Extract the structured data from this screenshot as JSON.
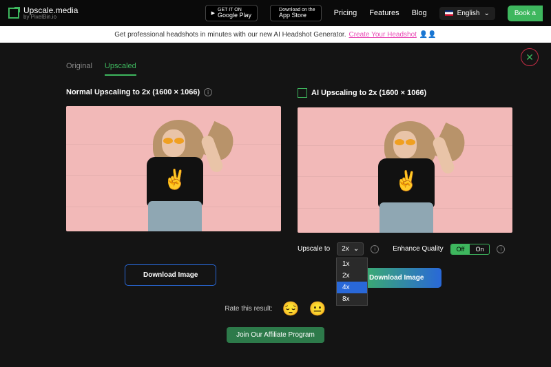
{
  "header": {
    "logo_name": "Upscale.media",
    "logo_sub": "by PixelBin.io",
    "store_google_top": "GET IT ON",
    "store_google_bottom": "Google Play",
    "store_apple_top": "Download on the",
    "store_apple_bottom": "App Store",
    "nav": {
      "pricing": "Pricing",
      "features": "Features",
      "blog": "Blog"
    },
    "language": "English",
    "book": "Book a"
  },
  "banner": {
    "text": "Get professional headshots in minutes with our new AI Headshot Generator.",
    "link": "Create Your Headshot"
  },
  "tabs": {
    "original": "Original",
    "upscaled": "Upscaled"
  },
  "left": {
    "title": "Normal Upscaling to 2x (1600 × 1066)",
    "download": "Download Image"
  },
  "right": {
    "title": "AI Upscaling to 2x (1600 × 1066)",
    "upscale_label": "Upscale to",
    "upscale_value": "2x",
    "options": [
      "1x",
      "2x",
      "4x",
      "8x"
    ],
    "selected_option": "4x",
    "enhance_label": "Enhance Quality",
    "off": "Off",
    "on": "On",
    "download": "Download Image"
  },
  "rating": {
    "label": "Rate this result:"
  },
  "affiliate": "Join Our Affiliate Program"
}
